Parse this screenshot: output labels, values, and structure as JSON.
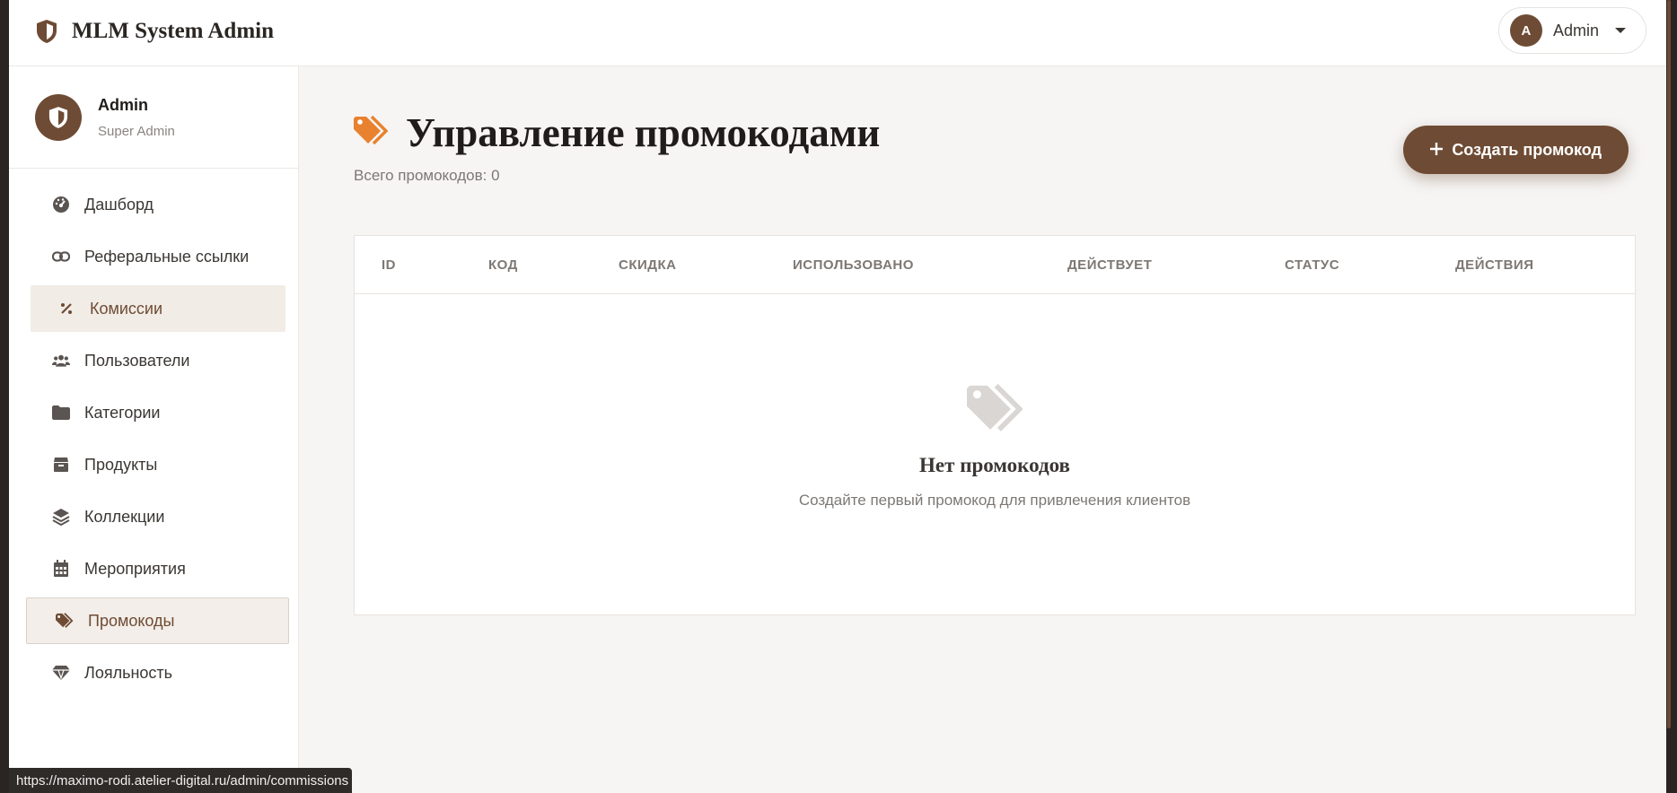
{
  "app": {
    "title": "MLM System Admin"
  },
  "user_menu": {
    "avatar_initial": "A",
    "name": "Admin"
  },
  "profile": {
    "name": "Admin",
    "role": "Super Admin"
  },
  "sidebar": {
    "items": [
      {
        "label": "Дашборд",
        "icon": "dashboard-icon"
      },
      {
        "label": "Реферальные ссылки",
        "icon": "link-icon"
      },
      {
        "label": "Комиссии",
        "icon": "percent-icon"
      },
      {
        "label": "Пользователи",
        "icon": "users-icon"
      },
      {
        "label": "Категории",
        "icon": "folder-icon"
      },
      {
        "label": "Продукты",
        "icon": "box-icon"
      },
      {
        "label": "Коллекции",
        "icon": "layers-icon"
      },
      {
        "label": "Мероприятия",
        "icon": "calendar-icon"
      },
      {
        "label": "Промокоды",
        "icon": "tags-icon"
      },
      {
        "label": "Лояльность",
        "icon": "gem-icon"
      }
    ]
  },
  "page": {
    "title": "Управление промокодами",
    "subtitle": "Всего промокодов: 0",
    "create_button": "Создать промокод"
  },
  "table": {
    "columns": [
      "ID",
      "КОД",
      "СКИДКА",
      "ИСПОЛЬЗОВАНО",
      "ДЕЙСТВУЕТ",
      "СТАТУС",
      "ДЕЙСТВИЯ"
    ],
    "empty_title": "Нет промокодов",
    "empty_text": "Создайте первый промокод для привлечения клиентов"
  },
  "status_bar": {
    "url": "https://maximo-rodi.atelier-digital.ru/admin/commissions"
  },
  "colors": {
    "brand": "#6e4b34",
    "accent": "#e8822e"
  }
}
